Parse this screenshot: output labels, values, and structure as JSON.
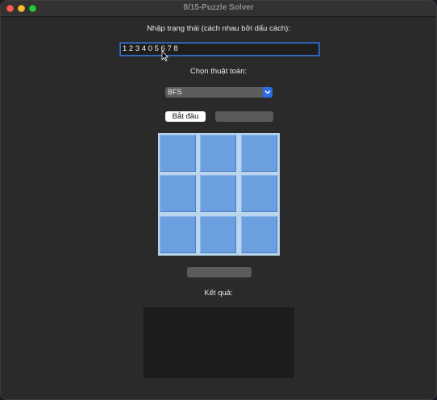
{
  "window": {
    "title": "8/15-Puzzle Solver"
  },
  "input_section": {
    "label": "Nhập trạng thái (cách nhau bởi dấu cách):",
    "value": "1 2 3 4 0 5 6 7 8"
  },
  "algorithm_section": {
    "label": "Chọn thuật toán:",
    "selected": "BFS"
  },
  "buttons": {
    "start_label": "Bắt đầu",
    "next_label": "",
    "solve_label": ""
  },
  "board": {
    "tiles": [
      "",
      "",
      "",
      "",
      "",
      "",
      "",
      "",
      ""
    ]
  },
  "result": {
    "label": "Kết quả:",
    "text": ""
  },
  "colors": {
    "window_bg": "#2a2a2a",
    "tile_fill": "#6c9fe0",
    "board_bg": "#b9d6ee",
    "select_arrow": "#2d6ce4",
    "input_focus": "#3b6fc2"
  }
}
